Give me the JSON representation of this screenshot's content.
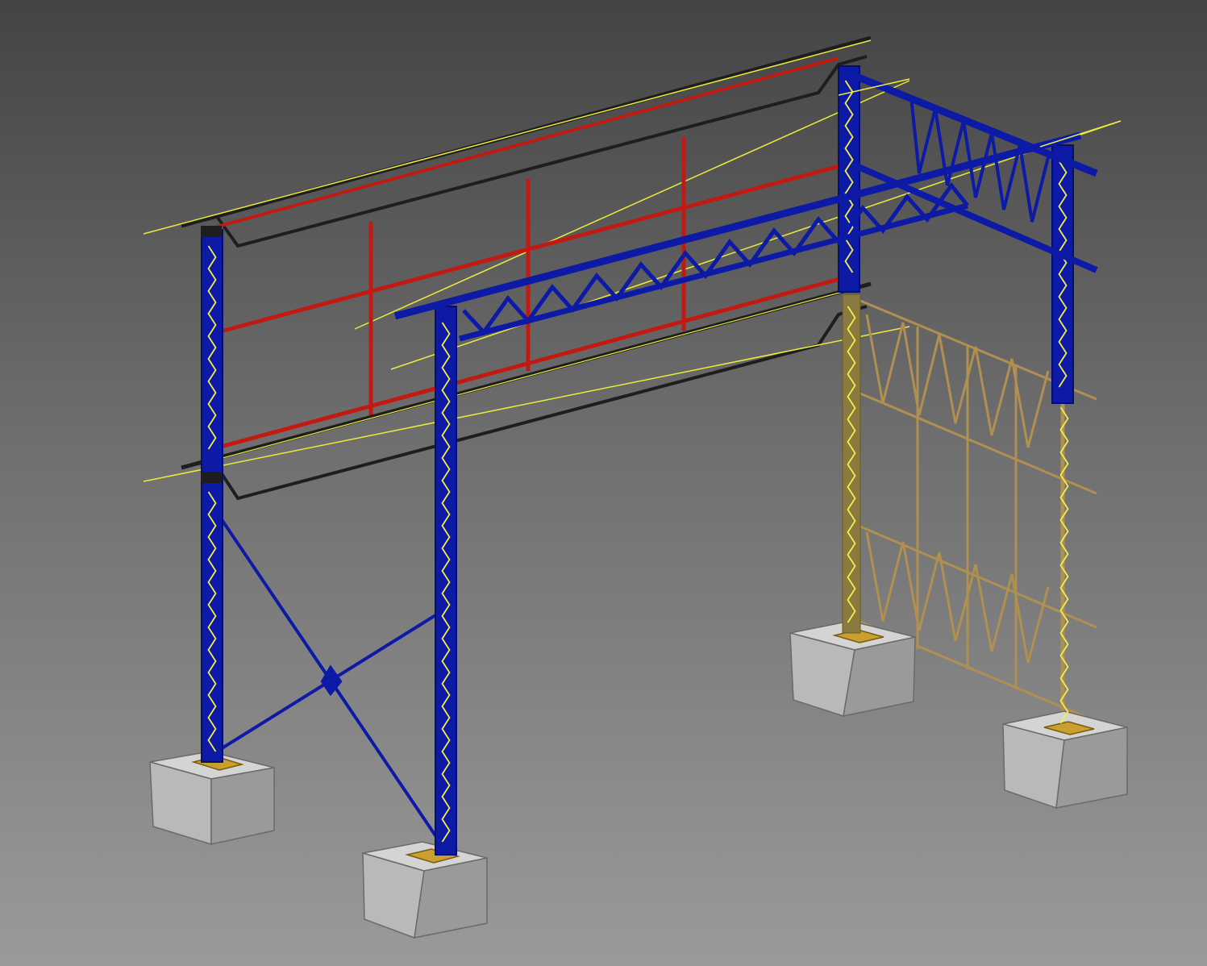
{
  "viewport": {
    "title": "",
    "background_top": "#444444",
    "background_bottom": "#9a9a9a"
  },
  "colors": {
    "steel_frame": "#0d1aa6",
    "steel_frame_dark": "#05106e",
    "lattice_wire": "#f2ee4a",
    "red_frame": "#c21a12",
    "gutter": "#202020",
    "purlin_line": "#ecec3c",
    "tan_panel": "#b09050",
    "concrete_light": "#d4d4d4",
    "concrete_mid": "#b9b9b9",
    "concrete_dark": "#9a9a9a",
    "base_plate": "#c9a030"
  },
  "scene": {
    "description_visible": false,
    "icons": [
      "steel-column-icon",
      "truss-beam-icon",
      "concrete-footing-icon",
      "cross-brace-icon",
      "gutter-icon"
    ]
  }
}
